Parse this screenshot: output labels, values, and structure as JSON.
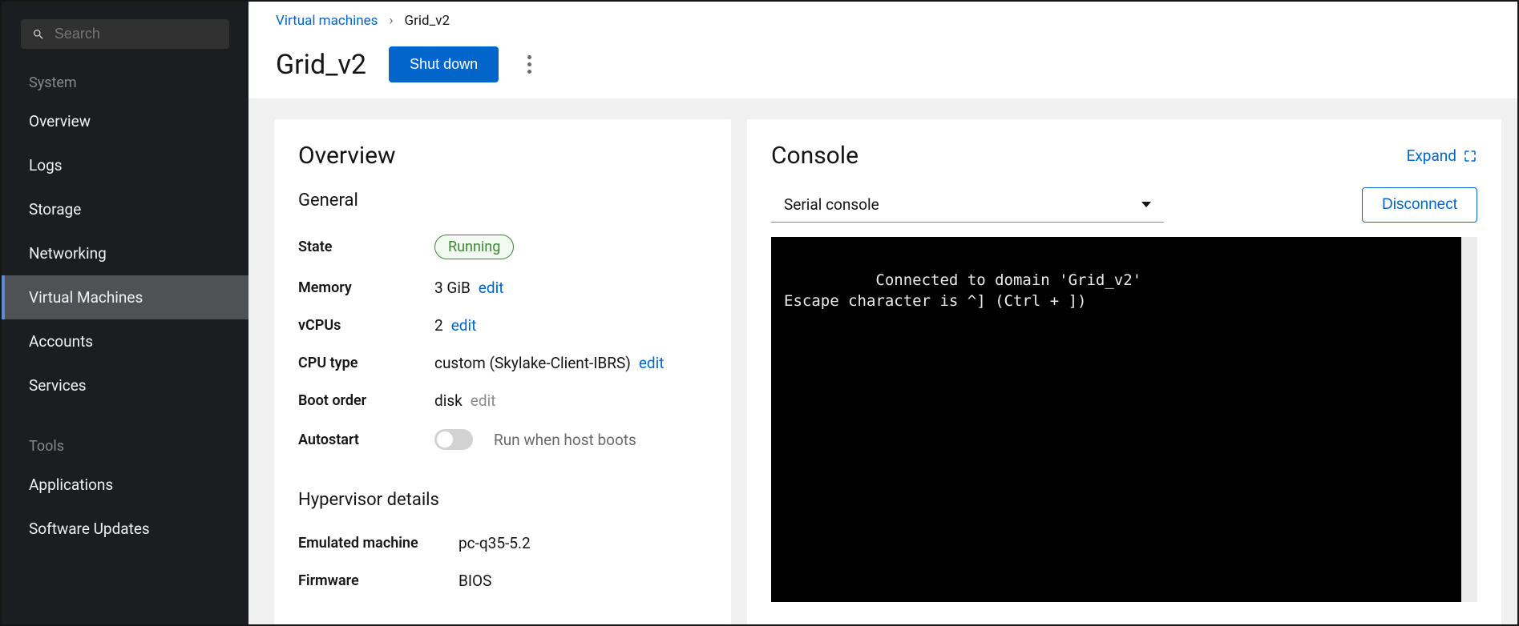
{
  "sidebar": {
    "search_placeholder": "Search",
    "groups": [
      {
        "label": "System",
        "items": [
          {
            "label": "Overview"
          },
          {
            "label": "Logs"
          },
          {
            "label": "Storage"
          },
          {
            "label": "Networking"
          },
          {
            "label": "Virtual Machines",
            "active": true
          },
          {
            "label": "Accounts"
          },
          {
            "label": "Services"
          }
        ]
      },
      {
        "label": "Tools",
        "items": [
          {
            "label": "Applications"
          },
          {
            "label": "Software Updates"
          }
        ]
      }
    ]
  },
  "breadcrumb": {
    "parent": "Virtual machines",
    "current": "Grid_v2"
  },
  "page": {
    "title": "Grid_v2",
    "shutdown_label": "Shut down"
  },
  "overview": {
    "card_title": "Overview",
    "general_title": "General",
    "rows": {
      "state": {
        "label": "State",
        "value": "Running"
      },
      "memory": {
        "label": "Memory",
        "value": "3 GiB",
        "edit": "edit"
      },
      "vcpus": {
        "label": "vCPUs",
        "value": "2",
        "edit": "edit"
      },
      "cpu_type": {
        "label": "CPU type",
        "value": "custom (Skylake-Client-IBRS)",
        "edit": "edit"
      },
      "boot_order": {
        "label": "Boot order",
        "value": "disk",
        "edit": "edit"
      },
      "autostart": {
        "label": "Autostart",
        "desc": "Run when host boots"
      }
    },
    "hypervisor_title": "Hypervisor details",
    "hypervisor": {
      "emulated_machine": {
        "label": "Emulated machine",
        "value": "pc-q35-5.2"
      },
      "firmware": {
        "label": "Firmware",
        "value": "BIOS"
      }
    }
  },
  "console": {
    "title": "Console",
    "expand_label": "Expand",
    "select_value": "Serial console",
    "disconnect_label": "Disconnect",
    "output": "Connected to domain 'Grid_v2'\nEscape character is ^] (Ctrl + ])\n"
  }
}
